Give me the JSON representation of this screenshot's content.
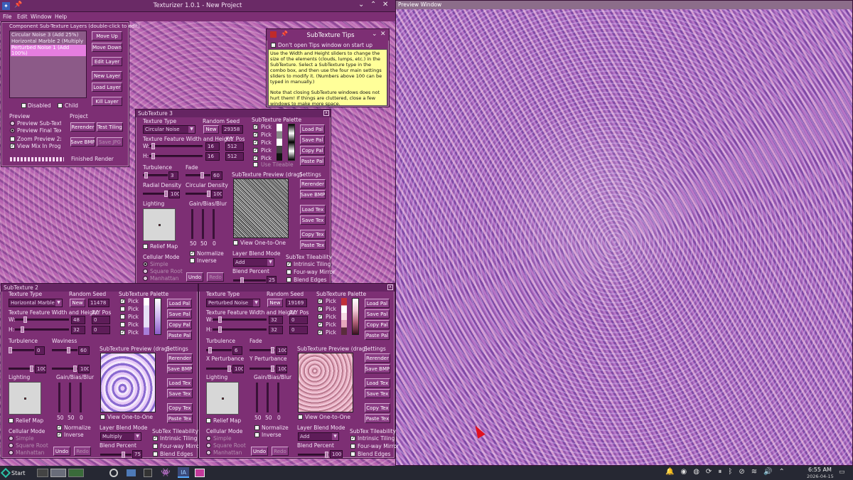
{
  "main": {
    "title": "Texturizer 1.0.1 - New Project",
    "menu": [
      "File",
      "Edit",
      "Window",
      "Help"
    ]
  },
  "preview_window": {
    "title": "Preview Window"
  },
  "layers": {
    "group_title": "Component Sub-Texture Layers (double-click to edit)",
    "items": [
      "Circular Noise 3 (Add 25%)",
      "Horizontal Marble 2 (Multiply 75%)",
      "Perturbed Noise 1 (Add 100%)"
    ],
    "buttons": [
      "Move Up",
      "Move Down",
      "Edit Layer",
      "New Layer",
      "Load Layer",
      "Kill Layer"
    ],
    "disabled": "Disabled",
    "child": "Child",
    "preview_title": "Preview",
    "preview_opts": [
      "Preview Sub-Texture",
      "Preview Final Texture",
      "Zoom Preview 2x2",
      "View Mix In Progress"
    ],
    "project_title": "Project",
    "rerender": "Rerender",
    "test_tiling": "Test Tiling",
    "save_bmp": "Save BMP",
    "save_jpg": "Save JPG",
    "status": "Finished Render"
  },
  "tips": {
    "title": "SubTexture Tips",
    "dont_open": "Don't open Tips window on start up",
    "text1": "Use the Width and Height sliders to change the size of the elements (clouds, lumps, etc.) in the SubTexture. Select a SubTexture type in the combo box, and then use the four main settings sliders to modify it. (Numbers above 100 can be typed in manually.)",
    "text2": "Note that closing SubTexture windows does not hurt them! If things are cluttered, close a few windows to make more space."
  },
  "common": {
    "texture_type": "Texture Type",
    "random_seed": "Random Seed",
    "new": "New",
    "palette": "SubTexture Palette",
    "feature": "Texture Feature Width and Height",
    "xy": "X/Y Pos",
    "w": "W:",
    "h": "H:",
    "pick": "Pick",
    "load_pal": "Load Pal",
    "save_pal": "Save Pal",
    "copy_pal": "Copy Pal",
    "paste_pal": "Paste Pal",
    "preview": "SubTexture Preview (drag)",
    "settings": "Settings",
    "rerender": "Rerender",
    "save_bmp": "Save BMP",
    "load_tex": "Load Tex",
    "save_tex": "Save Tex",
    "copy_tex": "Copy Tex",
    "paste_tex": "Paste Tex",
    "lighting": "Lighting",
    "gbb": "Gain/Bias/Blur",
    "relief": "Relief Map",
    "view": "View One-to-One",
    "normalize": "Normalize",
    "inverse": "Inverse",
    "cellular": "Cellular Mode",
    "cell_opts": [
      "Simple",
      "Square Root",
      "Manhattan"
    ],
    "undo": "Undo",
    "redo": "Redo",
    "blend_mode": "Layer Blend Mode",
    "blend_pct": "Blend Percent",
    "tileability": "SubTex Tileability",
    "tile_opts": [
      "Intrinsic Tiling",
      "Four-way Mirror",
      "Blend Edges"
    ],
    "use_tileable": "Use Tileable"
  },
  "st3": {
    "title": "SubTexture 3",
    "type": "Circular Noise",
    "seed": "29358",
    "w": "16",
    "h": "16",
    "x": "512",
    "y": "512",
    "p1": "Turbulence",
    "p1v": "3",
    "p2": "Fade",
    "p2v": "60",
    "p3": "Radial Density",
    "p3v": "100",
    "p4": "Circular Density",
    "p4v": "100",
    "g": "50",
    "b": "50",
    "bl": "0",
    "mode": "Add",
    "pct": "25"
  },
  "st2": {
    "title": "SubTexture 2",
    "type": "Horizontal Marble",
    "seed": "11478",
    "w": "48",
    "h": "32",
    "x": "0",
    "y": "0",
    "p1": "Turbulence",
    "p1v": "0",
    "p2": "Waviness",
    "p2v": "60",
    "p3v": "100",
    "p4v": "100",
    "g": "50",
    "b": "50",
    "bl": "0",
    "mode": "Multiply",
    "pct": "75"
  },
  "st1": {
    "title": "",
    "type": "Perturbed Noise",
    "seed": "19169",
    "w": "32",
    "h": "32",
    "x": "0",
    "y": "0",
    "p1": "Turbulence",
    "p1v": "6",
    "p2": "Fade",
    "p2v": "100",
    "p3": "X Perturbance",
    "p3v": "100",
    "p4": "Y Perturbance",
    "p4v": "100",
    "g": "50",
    "b": "50",
    "bl": "0",
    "mode": "Add",
    "pct": "100"
  },
  "taskbar": {
    "start": "Start",
    "time": "6:55 AM",
    "date": "2026-04-15"
  }
}
